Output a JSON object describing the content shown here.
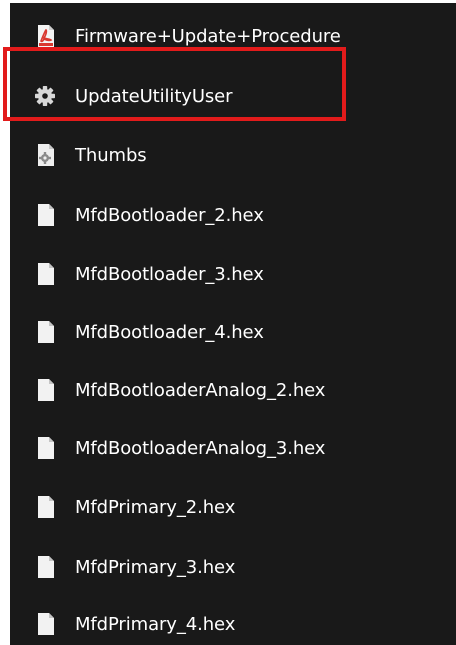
{
  "files": [
    {
      "name": "Firmware+Update+Procedure",
      "icon": "pdf-file-icon"
    },
    {
      "name": "UpdateUtilityUser",
      "icon": "gear-icon"
    },
    {
      "name": "Thumbs",
      "icon": "system-file-icon"
    },
    {
      "name": "MfdBootloader_2.hex",
      "icon": "document-icon"
    },
    {
      "name": "MfdBootloader_3.hex",
      "icon": "document-icon"
    },
    {
      "name": "MfdBootloader_4.hex",
      "icon": "document-icon"
    },
    {
      "name": "MfdBootloaderAnalog_2.hex",
      "icon": "document-icon"
    },
    {
      "name": "MfdBootloaderAnalog_3.hex",
      "icon": "document-icon"
    },
    {
      "name": "MfdPrimary_2.hex",
      "icon": "document-icon"
    },
    {
      "name": "MfdPrimary_3.hex",
      "icon": "document-icon"
    },
    {
      "name": "MfdPrimary_4.hex",
      "icon": "document-icon"
    }
  ],
  "colors": {
    "background": "#191919",
    "text": "#ffffff",
    "highlight": "#e21b1b",
    "pdf_icon": "#d9382f"
  }
}
